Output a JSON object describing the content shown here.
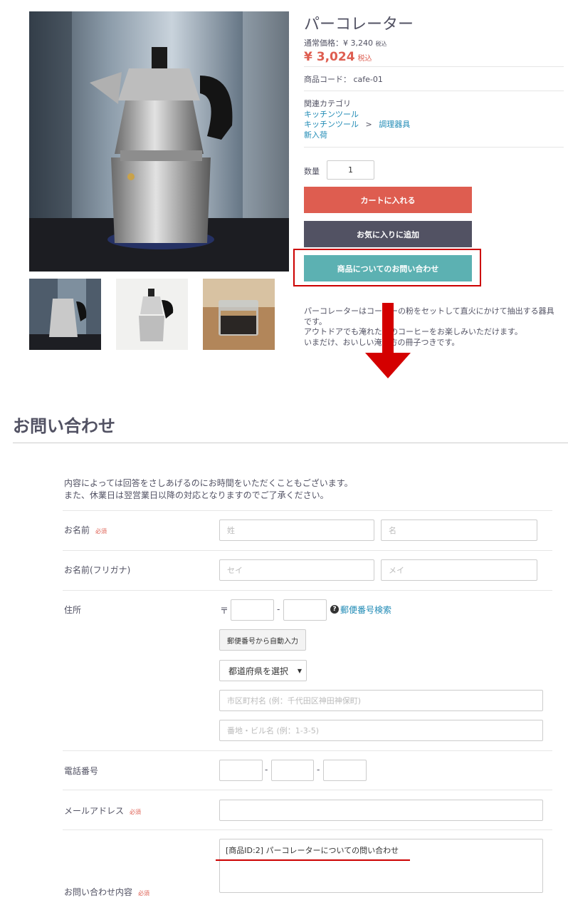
{
  "product": {
    "title": "パーコレーター",
    "regular_price_label": "通常価格：¥ 3,240",
    "regular_price_tax": "税込",
    "price": "¥ 3,024",
    "price_tax": "税込",
    "code_label": "商品コード：",
    "code": "cafe-01",
    "category_heading": "関連カテゴリ",
    "categories": [
      "キッチンツール",
      "キッチンツール",
      "調理器具",
      "新入荷"
    ],
    "breadcrumb_sep": ">",
    "qty_label": "数量",
    "qty_value": "1",
    "cart_button": "カートに入れる",
    "favorite_button": "お気に入りに追加",
    "inquiry_button": "商品についてのお問い合わせ",
    "description": [
      "パーコレーターはコーヒーの粉をセットして直火にかけて抽出する器具です。",
      "アウトドアでも淹れたてのコーヒーをお楽しみいただけます。",
      "いまだけ、おいしい淹れ方の冊子つきです。"
    ]
  },
  "contact": {
    "heading": "お問い合わせ",
    "intro_line1": "内容によっては回答をさしあげるのにお時間をいただくこともございます。",
    "intro_line2": "また、休業日は翌営業日以降の対応となりますのでご了承ください。",
    "required": "必須",
    "name_label": "お名前",
    "last_name_ph": "姓",
    "first_name_ph": "名",
    "kana_label": "お名前(フリガナ)",
    "kana_last_ph": "セイ",
    "kana_first_ph": "メイ",
    "address_label": "住所",
    "postal_mark": "〒",
    "dash": "-",
    "postal_search": "郵便番号検索",
    "postal_help": "?",
    "autofill_button": "郵便番号から自動入力",
    "pref_select": "都道府県を選択",
    "city_ph": "市区町村名 (例：千代田区神田神保町)",
    "street_ph": "番地・ビル名 (例：1-3-5)",
    "phone_label": "電話番号",
    "email_label": "メールアドレス",
    "inquiry_label": "お問い合わせ内容",
    "inquiry_value": "[商品ID:2] パーコレーターについての問い合わせ"
  },
  "colors": {
    "cart": "#de5d50",
    "favorite": "#525263",
    "inquiry": "#5cb1b2",
    "highlight": "#cc0000"
  }
}
